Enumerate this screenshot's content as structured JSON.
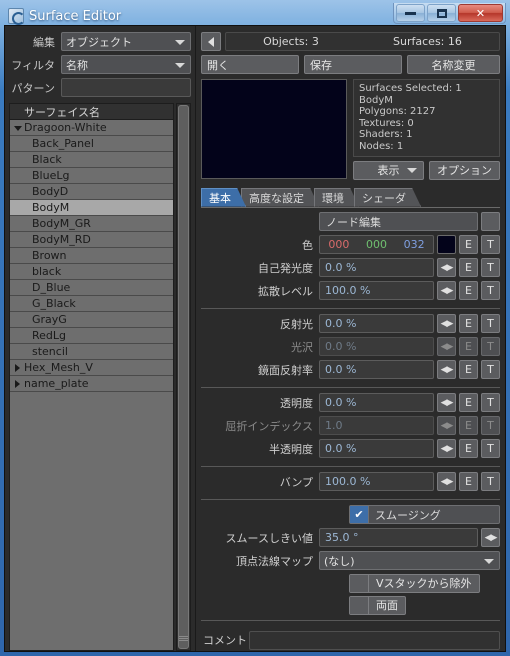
{
  "window": {
    "title": "Surface Editor",
    "icon": "surface-editor-icon",
    "minimize_label": "–",
    "maximize_label": "□",
    "close_label": "✕"
  },
  "left": {
    "edit_label": "編集",
    "edit_value": "オブジェクト",
    "filter_label": "フィルタ",
    "filter_value": "名称",
    "pattern_label": "パターン",
    "pattern_value": "",
    "list_header": "サーフェイス名",
    "items": [
      {
        "label": "Dragoon-White",
        "type": "node-open",
        "selected": false
      },
      {
        "label": "Back_Panel",
        "type": "leaf",
        "selected": false
      },
      {
        "label": "Black",
        "type": "leaf",
        "selected": false
      },
      {
        "label": "BlueLg",
        "type": "leaf",
        "selected": false
      },
      {
        "label": "BodyD",
        "type": "leaf",
        "selected": false
      },
      {
        "label": "BodyM",
        "type": "leaf",
        "selected": true
      },
      {
        "label": "BodyM_GR",
        "type": "leaf",
        "selected": false
      },
      {
        "label": "BodyM_RD",
        "type": "leaf",
        "selected": false
      },
      {
        "label": "Brown",
        "type": "leaf",
        "selected": false
      },
      {
        "label": "black",
        "type": "leaf",
        "selected": false
      },
      {
        "label": "D_Blue",
        "type": "leaf",
        "selected": false
      },
      {
        "label": "G_Black",
        "type": "leaf",
        "selected": false
      },
      {
        "label": "GrayG",
        "type": "leaf",
        "selected": false
      },
      {
        "label": "RedLg",
        "type": "leaf",
        "selected": false
      },
      {
        "label": "stencil",
        "type": "leaf",
        "selected": false
      },
      {
        "label": "Hex_Mesh_V",
        "type": "node-closed",
        "selected": false
      },
      {
        "label": "name_plate",
        "type": "node-closed",
        "selected": false
      }
    ]
  },
  "right": {
    "objects_count": "Objects: 3",
    "surfaces_count": "Surfaces: 16",
    "open_label": "開く",
    "save_label": "保存",
    "rename_label": "名称変更",
    "preview_color": "#03031a",
    "stats": [
      "Surfaces Selected: 1",
      "BodyM",
      "Polygons: 2127",
      "Textures: 0",
      "Shaders: 1",
      "Nodes: 1"
    ],
    "display_label": "表示",
    "options_label": "オプション",
    "tabs": [
      {
        "label": "基本",
        "active": true
      },
      {
        "label": "高度な設定",
        "active": false
      },
      {
        "label": "環境",
        "active": false
      },
      {
        "label": "シェーダ",
        "active": false
      }
    ],
    "node_edit_label": "ノード編集",
    "color": {
      "label": "色",
      "r": "000",
      "g": "000",
      "b": "032",
      "swatch": "#03031a",
      "r_color": "#d96a6a",
      "g_color": "#6fbf6f",
      "b_color": "#7f9fe0"
    },
    "params": [
      {
        "label": "自己発光度",
        "value": "0.0 %",
        "dim": false
      },
      {
        "label": "拡散レベル",
        "value": "100.0 %",
        "dim": false
      },
      {
        "label": "反射光",
        "value": "0.0 %",
        "dim": false
      },
      {
        "label": "光沢",
        "value": "0.0 %",
        "dim": true
      },
      {
        "label": "鏡面反射率",
        "value": "0.0 %",
        "dim": false
      },
      {
        "label": "透明度",
        "value": "0.0 %",
        "dim": false
      },
      {
        "label": "屈折インデックス",
        "value": "1.0",
        "dim": true
      },
      {
        "label": "半透明度",
        "value": "0.0 %",
        "dim": false
      },
      {
        "label": "バンプ",
        "value": "100.0 %",
        "dim": false
      }
    ],
    "edit_button_label": "E",
    "texture_button_label": "T",
    "arrows_glyph": "◀▶",
    "smoothing_label": "スムージング",
    "smoothing_checked": true,
    "check_glyph": "✔",
    "smooth_threshold_label": "スムースしきい値",
    "smooth_threshold_value": "35.0 °",
    "vertex_normal_label": "頂点法線マップ",
    "vertex_normal_value": "(なし)",
    "exclude_vstack_label": "Vスタックから除外",
    "double_sided_label": "両面",
    "comment_label": "コメント",
    "comment_value": ""
  }
}
